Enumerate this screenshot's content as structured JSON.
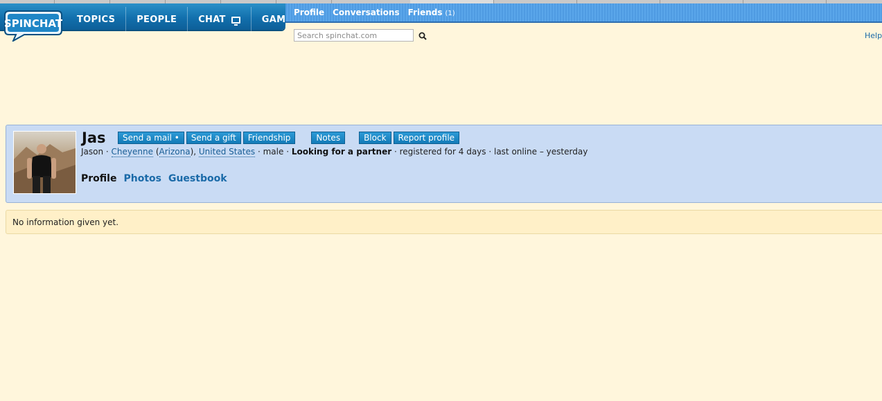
{
  "nav": {
    "logo_text": "SPINCHAT",
    "items": [
      "TOPICS",
      "PEOPLE",
      "CHAT",
      "GAMES"
    ]
  },
  "subnav": {
    "profile": "Profile",
    "conversations": "Conversations",
    "friends": "Friends",
    "friends_count": "(1)"
  },
  "search": {
    "placeholder": "Search spinchat.com",
    "icon": "search-icon"
  },
  "help": "Help",
  "profile": {
    "name": "Jas",
    "buttons": {
      "send_mail": "Send a mail •",
      "send_gift": "Send a gift",
      "friendship": "Friendship",
      "notes": "Notes",
      "block": "Block",
      "report": "Report profile"
    },
    "details": {
      "first_name": "Jason",
      "city": "Cheyenne",
      "state": "Arizona",
      "country": "United States",
      "gender": "male",
      "looking_for": "Looking for a partner",
      "registered": "registered for 4 days",
      "last_online": "last online – yesterday"
    },
    "tabs": [
      "Profile",
      "Photos",
      "Guestbook"
    ]
  },
  "info": "No information given yet.",
  "colors": {
    "nav_blue": "#1270ad",
    "subnav_blue": "#5aa6ea",
    "page_bg": "#fff6dc",
    "profile_bg": "#c9dbf4"
  }
}
